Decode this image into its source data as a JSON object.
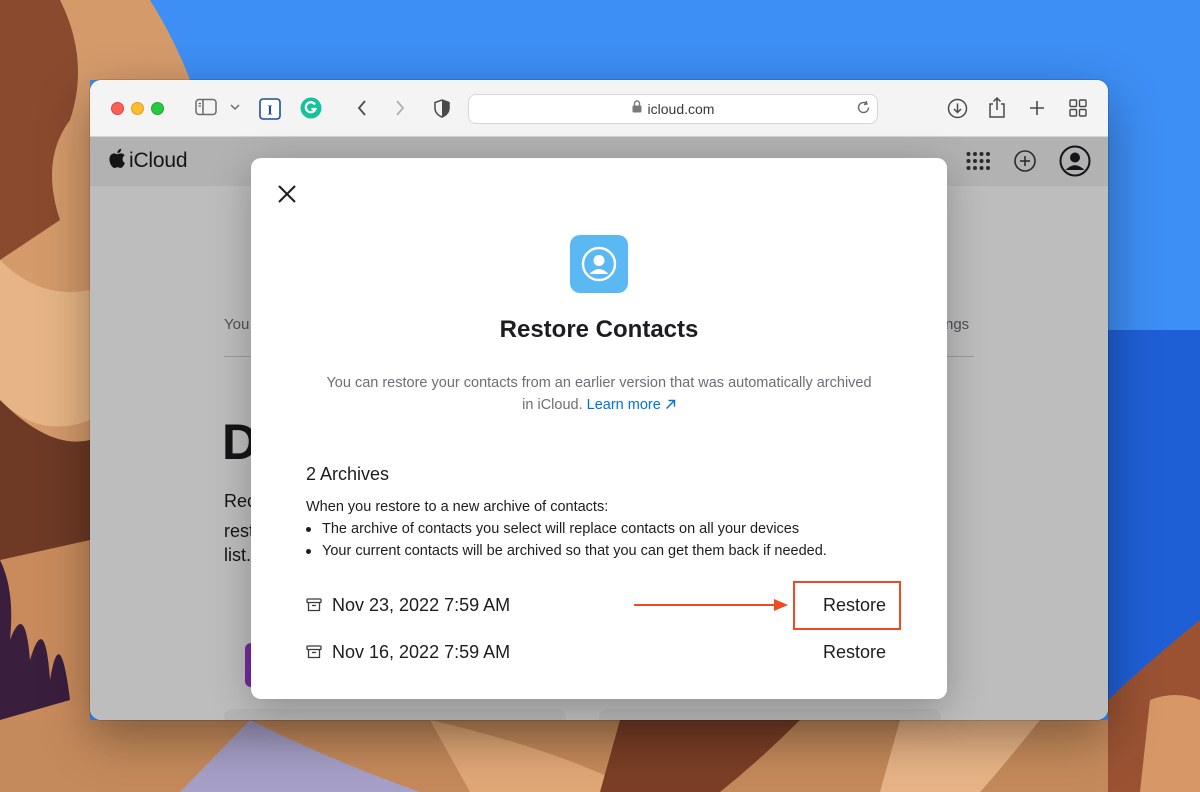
{
  "browser": {
    "url": "icloud.com"
  },
  "icloud": {
    "brand": "iCloud",
    "background": {
      "tab_left": "You",
      "tab_right": "ngs",
      "heading_fragment": "D",
      "paragraph_fragments": [
        "Rec",
        "rest",
        "list."
      ]
    }
  },
  "modal": {
    "title": "Restore Contacts",
    "description": "You can restore your contacts from an earlier version that was automatically archived in iCloud.",
    "learn_more": "Learn more",
    "archives_heading": "2 Archives",
    "info_intro": "When you restore to a new archive of contacts:",
    "info_points": [
      "The archive of contacts you select will replace contacts on all your devices",
      "Your current contacts will be archived so that you can get them back if needed."
    ],
    "archives": [
      {
        "date": "Nov 23, 2022 7:59 AM",
        "action": "Restore"
      },
      {
        "date": "Nov 16, 2022 7:59 AM",
        "action": "Restore"
      }
    ]
  },
  "colors": {
    "link": "#0071e3",
    "annotation": "#f04a24",
    "contacts_icon": "#5ab8f2"
  },
  "icons": [
    "sidebar-icon",
    "chevron-down-icon",
    "instapaper-icon",
    "grammarly-icon",
    "back-icon",
    "forward-icon",
    "shield-icon",
    "lock-icon",
    "reload-icon",
    "download-icon",
    "share-icon",
    "new-tab-icon",
    "tab-overview-icon",
    "apple-logo-icon",
    "app-grid-icon",
    "add-icon",
    "account-icon",
    "close-icon",
    "contacts-app-icon",
    "external-link-icon",
    "archive-box-icon"
  ]
}
